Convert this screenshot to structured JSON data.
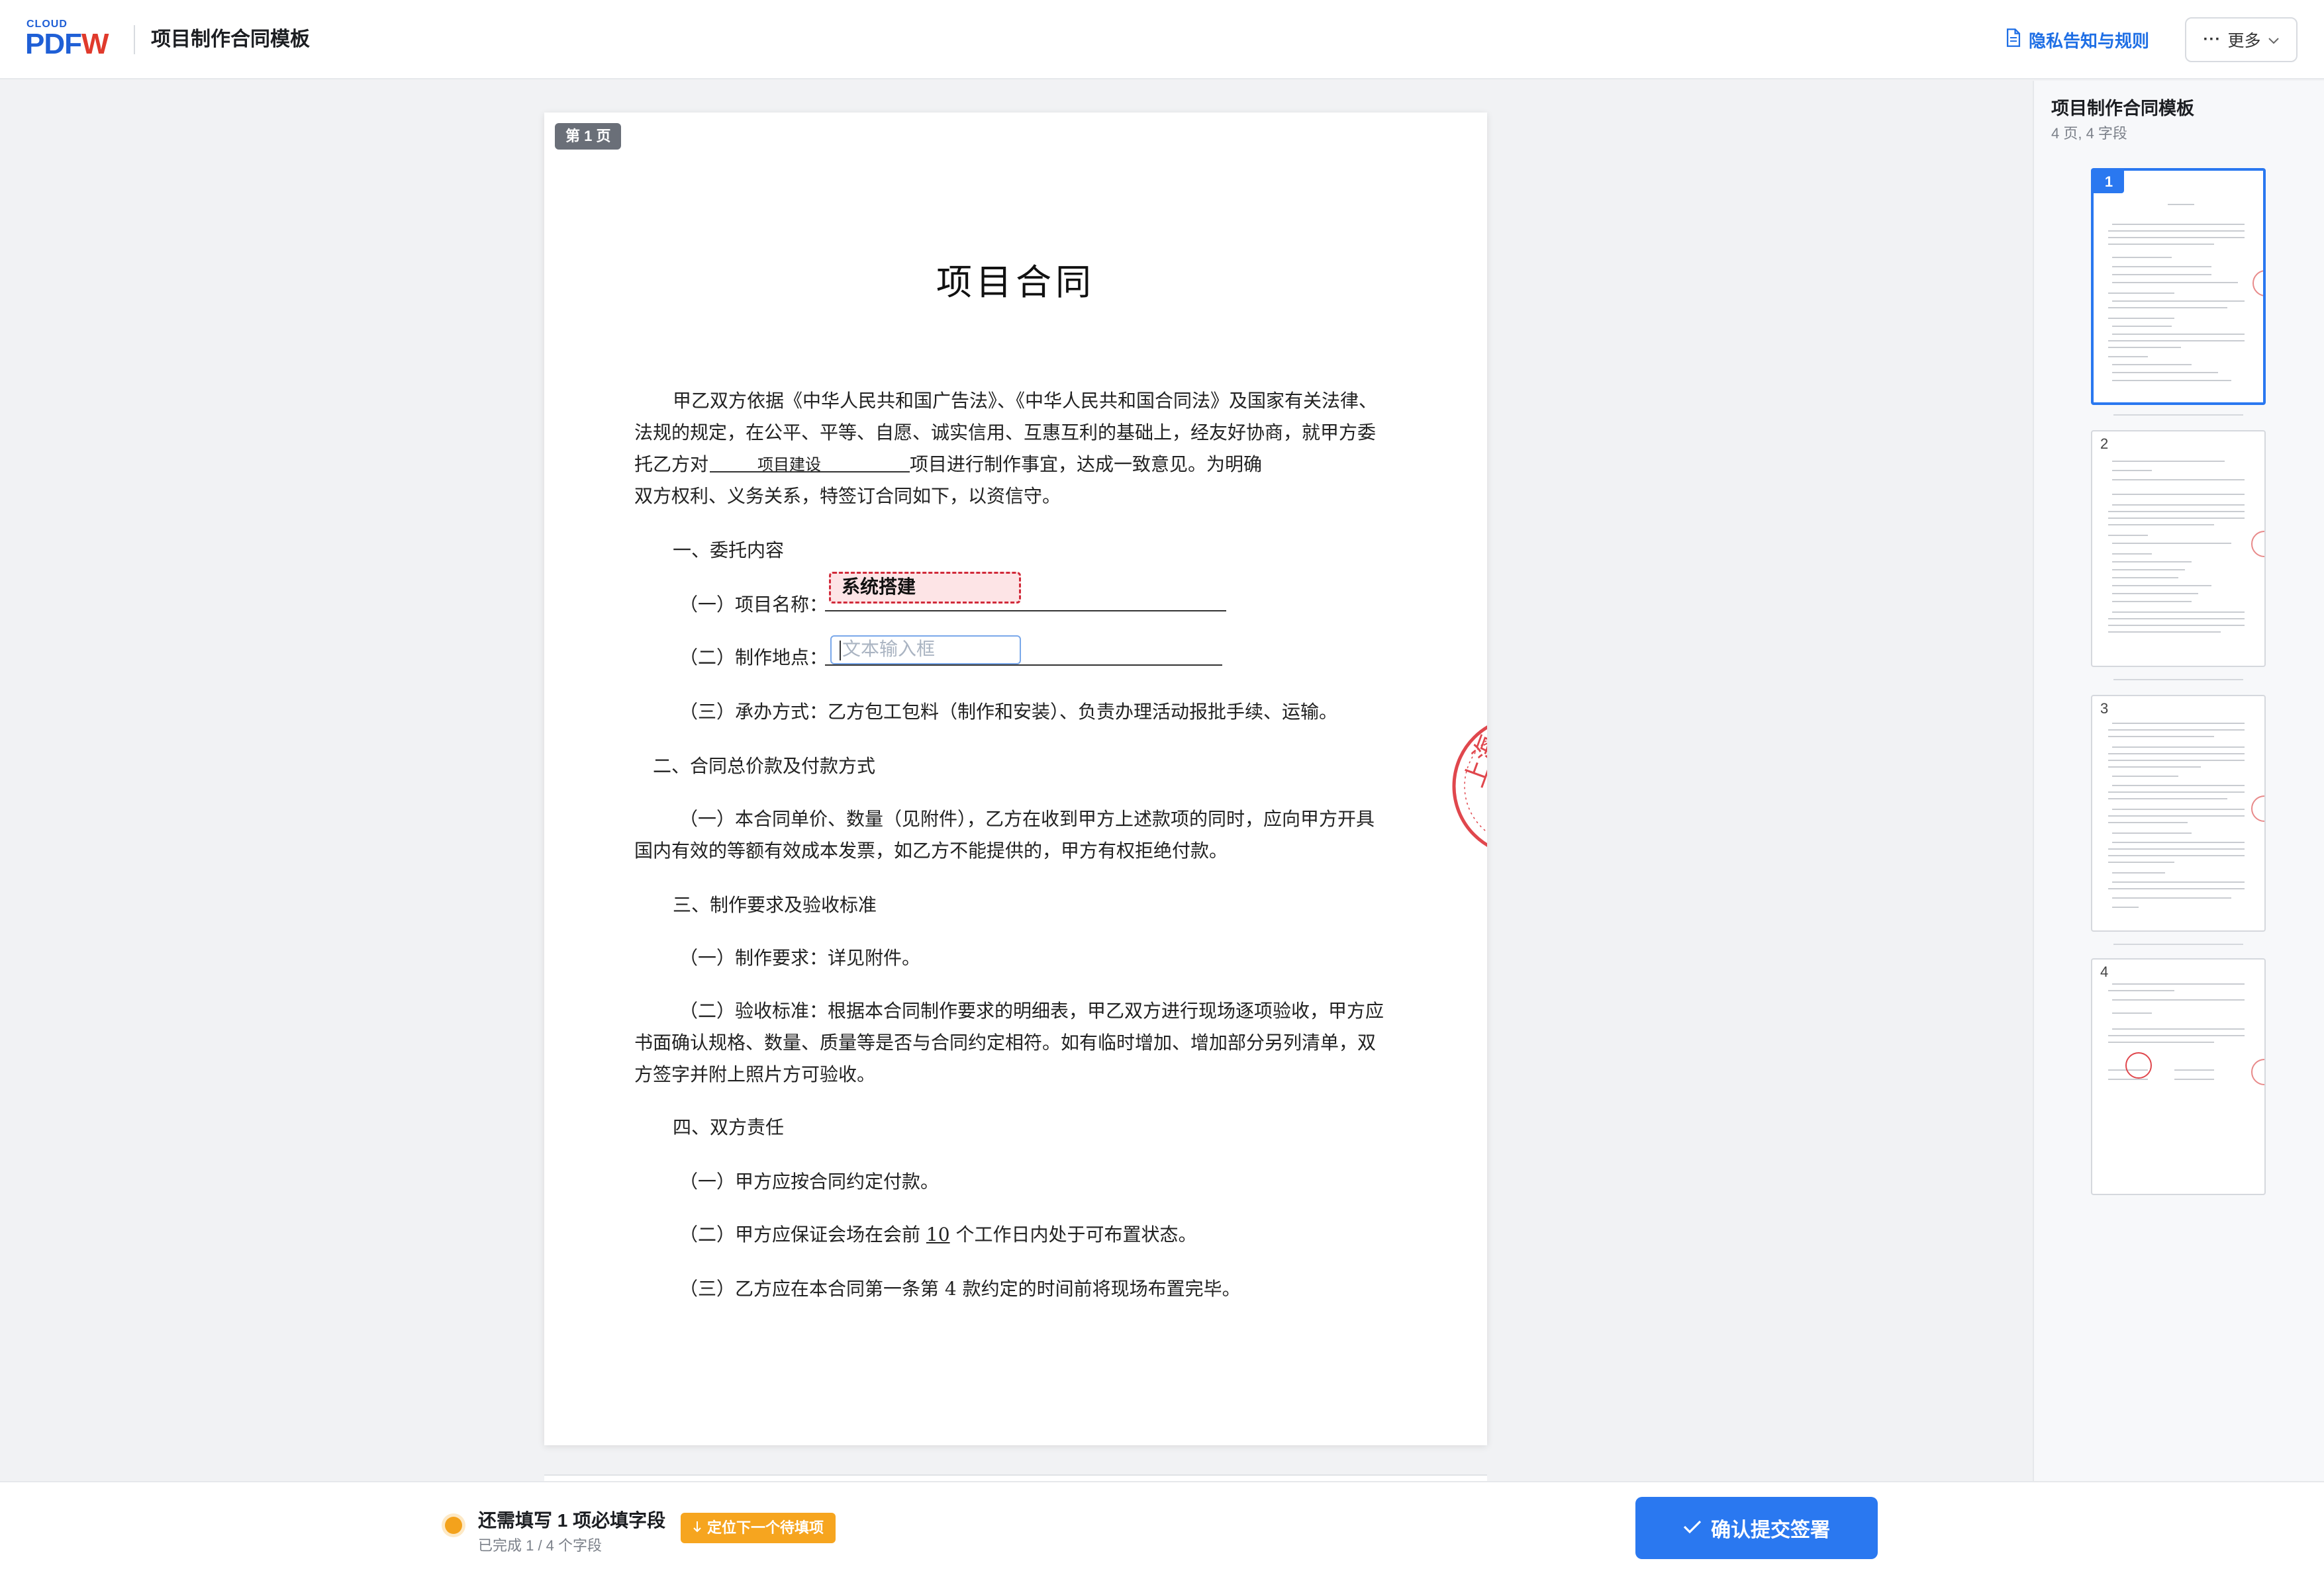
{
  "header": {
    "logo_top": "CLOUD",
    "logo_p": "PDF",
    "logo_w": "W",
    "title": "项目制作合同模板",
    "privacy_label": "隐私告知与规则",
    "more_dots": "···",
    "more_label": "更多"
  },
  "document": {
    "page_badge": "第 1 页",
    "title": "项目合同",
    "intro_1": "甲乙双方依据《中华人民共和国广告法》、《中华人民共和国合同法》及国家有关法律、",
    "intro_2": "法规的规定，在公平、平等、自愿、诚实信用、互惠互利的基础上，经友好协商，就甲方委",
    "intro_3a": "托乙方对",
    "intro_3_fill": "项目建设",
    "intro_3b": "项目进行制作事宜，达成一致意见。为明确",
    "intro_4": "双方权利、义务关系，特签订合同如下，以资信守。",
    "s1": "一、委托内容",
    "s1_1_label": "（一）项目名称：",
    "s1_1_value": "系统搭建",
    "s1_2_label": "（二）制作地点：",
    "s1_2_placeholder": "文本输入框",
    "s1_3": "（三）承办方式：乙方包工包料（制作和安装）、负责办理活动报批手续、运输。",
    "s2": "二、合同总价款及付款方式",
    "s2_1a": "（一）本合同单价、数量（见附件），乙方在收到甲方上述款项的同时，应向甲方开具",
    "s2_1b": "国内有效的等额有效成本发票，如乙方不能提供的，甲方有权拒绝付款。",
    "s3": "三、制作要求及验收标准",
    "s3_1": "（一）制作要求：详见附件。",
    "s3_2a": "（二）验收标准：根据本合同制作要求的明细表，甲乙双方进行现场逐项验收，甲方应",
    "s3_2b": "书面确认规格、数量、质量等是否与合同约定相符。如有临时增加、增加部分另列清单，双",
    "s3_2c": "方签字并附上照片方可验收。",
    "s4": "四、双方责任",
    "s4_1": "（一）甲方应按合同约定付款。",
    "s4_2a": "（二）甲方应保证会场在会前 ",
    "s4_2_num": "10",
    "s4_2b": " 个工作日内处于可布置状态。",
    "s4_3": "（三）乙方应在本合同第一条第 4 款约定的时间前将现场布置完毕。",
    "stamp_text": "上海"
  },
  "sidebar": {
    "title": "项目制作合同模板",
    "subtitle": "4 页, 4 字段",
    "pages": [
      {
        "num": "1"
      },
      {
        "num": "2"
      },
      {
        "num": "3"
      },
      {
        "num": "4"
      }
    ]
  },
  "footer": {
    "status_main": "还需填写 1 项必填字段",
    "status_sub": "已完成 1 / 4 个字段",
    "locate_label": "定位下一个待填项",
    "submit_label": "确认提交签署"
  },
  "colors": {
    "accent": "#2a78f0",
    "warning": "#f6a51f",
    "stamp": "#e0474d",
    "logo_blue": "#1f5fd6",
    "logo_red": "#e03a2c"
  }
}
